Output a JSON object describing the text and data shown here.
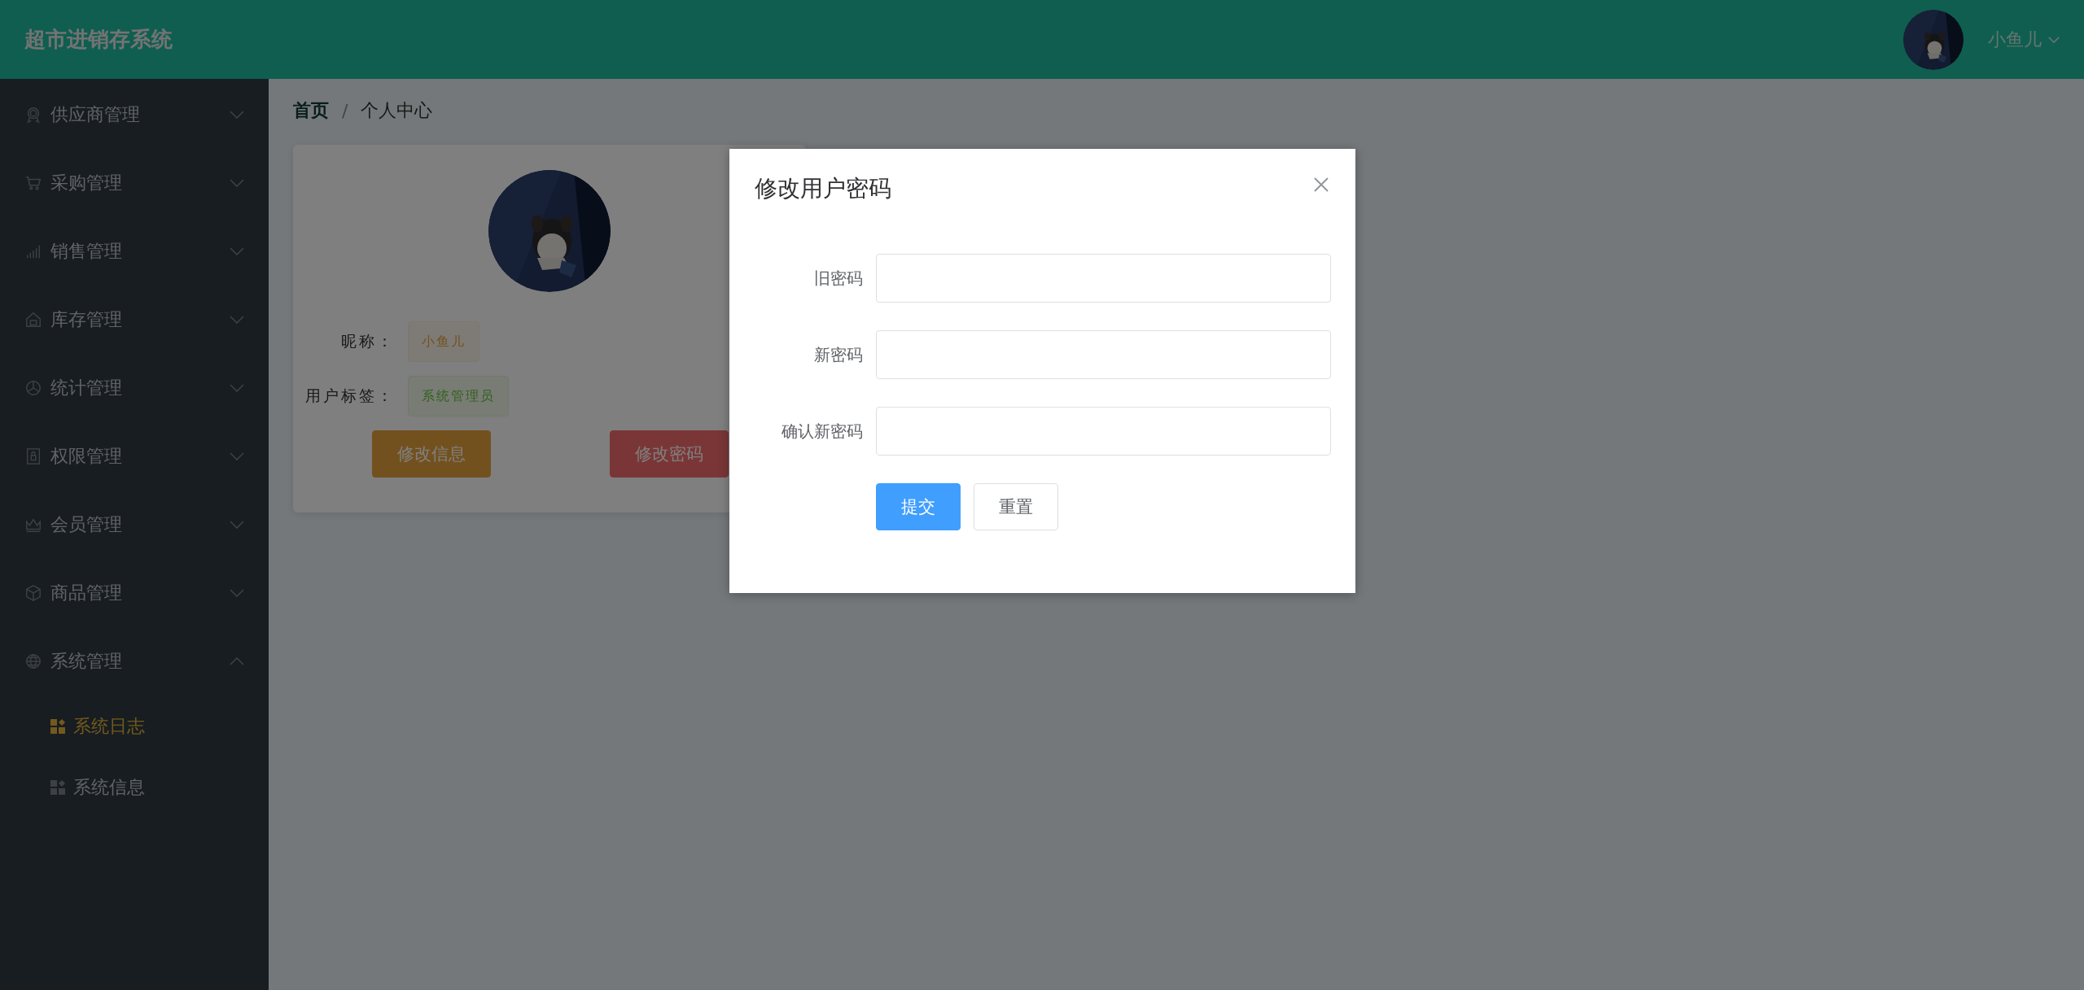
{
  "header": {
    "title": "超市进销存系统",
    "user": {
      "name": "小鱼儿"
    }
  },
  "sidebar": {
    "items": [
      {
        "label": "供应商管理",
        "expanded": false
      },
      {
        "label": "采购管理",
        "expanded": false
      },
      {
        "label": "销售管理",
        "expanded": false
      },
      {
        "label": "库存管理",
        "expanded": false
      },
      {
        "label": "统计管理",
        "expanded": false
      },
      {
        "label": "权限管理",
        "expanded": false
      },
      {
        "label": "会员管理",
        "expanded": false
      },
      {
        "label": "商品管理",
        "expanded": false
      },
      {
        "label": "系统管理",
        "expanded": true,
        "children": [
          {
            "label": "系统日志",
            "selected": true
          },
          {
            "label": "系统信息",
            "selected": false
          }
        ]
      }
    ]
  },
  "breadcrumb": {
    "separator": "/",
    "items": [
      {
        "label": "首页",
        "current": false
      },
      {
        "label": "个人中心",
        "current": true
      }
    ]
  },
  "profile_card": {
    "fields": [
      {
        "label": "昵称：",
        "value": "小鱼儿",
        "kind": "warning"
      },
      {
        "label": "用户标签：",
        "value": "系统管理员",
        "kind": "success"
      }
    ],
    "buttons": [
      {
        "label": "修改信息",
        "kind": "warning"
      },
      {
        "label": "修改密码",
        "kind": "danger"
      }
    ]
  },
  "dialog": {
    "title": "修改用户密码",
    "fields": [
      {
        "label": "旧密码"
      },
      {
        "label": "新密码"
      },
      {
        "label": "确认新密码"
      }
    ],
    "buttons": [
      {
        "label": "提交",
        "kind": "primary"
      },
      {
        "label": "重置",
        "kind": "default"
      }
    ]
  }
}
